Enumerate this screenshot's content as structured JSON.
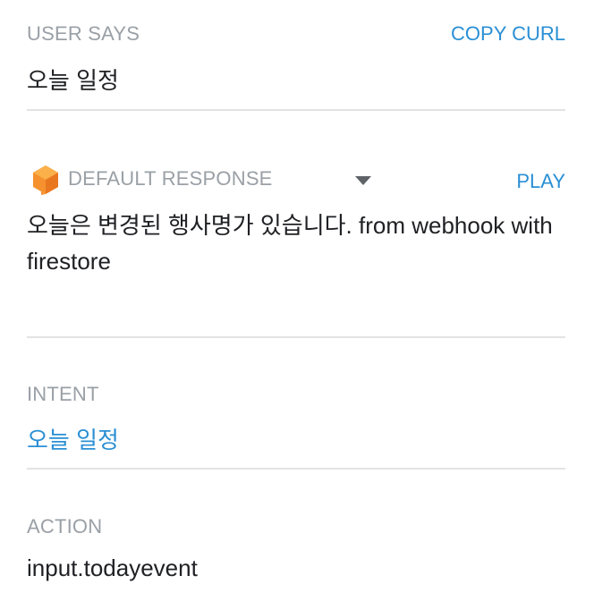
{
  "user_says": {
    "label": "USER SAYS",
    "copy_curl_label": "COPY CURL",
    "text": "오늘 일정"
  },
  "default_response": {
    "icon": "dialogflow-agent-icon",
    "label": "DEFAULT RESPONSE",
    "play_label": "PLAY",
    "text": "오늘은 변경된 행사명가 있습니다. from webhook with firestore"
  },
  "intent": {
    "label": "INTENT",
    "value": "오늘 일정"
  },
  "action": {
    "label": "ACTION",
    "value": "input.todayevent"
  },
  "colors": {
    "accent": "#2a8fd4",
    "label": "#9aa0a6",
    "text": "#202124",
    "icon_orange": "#f5922f",
    "divider": "#e3e3e3"
  }
}
